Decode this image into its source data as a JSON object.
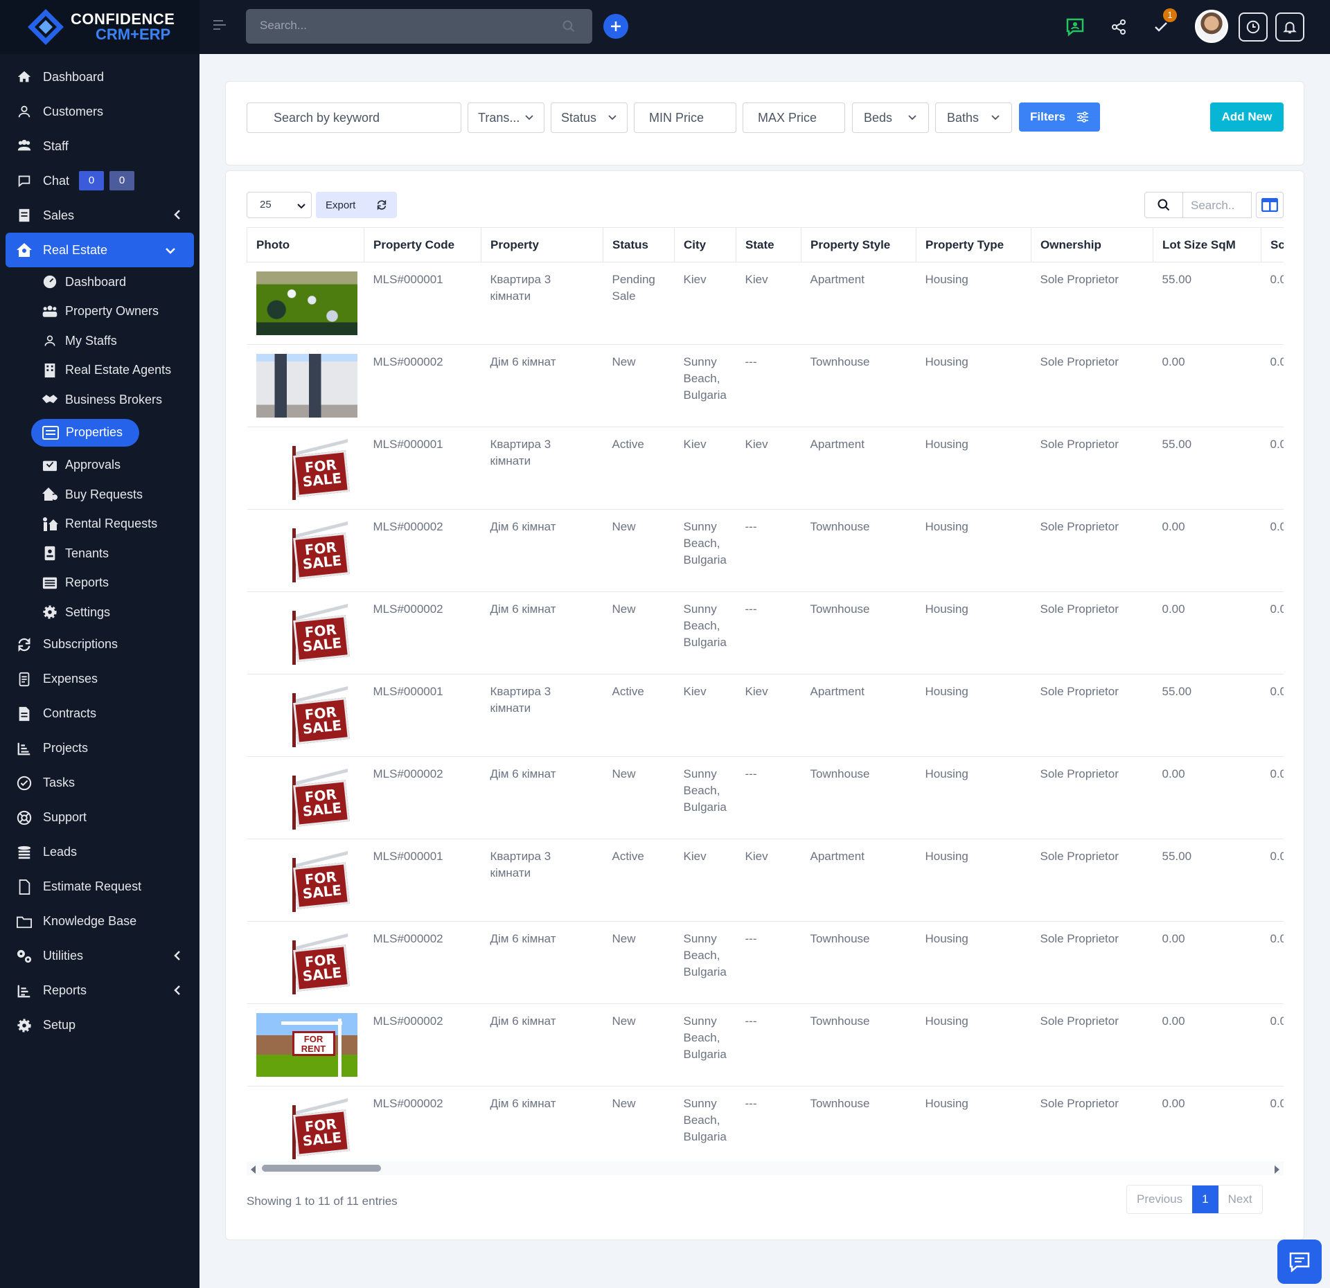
{
  "brand": {
    "line1": "CONFIDENCE",
    "line2": "CRM+ERP"
  },
  "topbar": {
    "search_placeholder": "Search...",
    "notification_count": "1"
  },
  "sidebar": {
    "items_top": [
      {
        "label": "Dashboard",
        "icon": "home-icon"
      },
      {
        "label": "Customers",
        "icon": "user-icon"
      },
      {
        "label": "Staff",
        "icon": "users-icon"
      }
    ],
    "chat": {
      "label": "Chat",
      "badge1": "0",
      "badge2": "0"
    },
    "sales": {
      "label": "Sales"
    },
    "real_estate": {
      "label": "Real Estate"
    },
    "sub_items": [
      {
        "label": "Dashboard",
        "icon": "gauge-icon"
      },
      {
        "label": "Property Owners",
        "icon": "people-icon"
      },
      {
        "label": "My Staffs",
        "icon": "user-icon"
      },
      {
        "label": "Real Estate Agents",
        "icon": "building-icon"
      },
      {
        "label": "Business Brokers",
        "icon": "handshake-icon"
      }
    ],
    "properties": {
      "label": "Properties"
    },
    "sub_items2": [
      {
        "label": "Approvals",
        "icon": "inbox-icon"
      },
      {
        "label": "Buy Requests",
        "icon": "house-tag-icon"
      },
      {
        "label": "Rental Requests",
        "icon": "person-house-icon"
      },
      {
        "label": "Tenants",
        "icon": "id-card-icon"
      },
      {
        "label": "Reports",
        "icon": "list-icon"
      },
      {
        "label": "Settings",
        "icon": "gear-icon"
      }
    ],
    "items_bottom": [
      {
        "label": "Subscriptions",
        "icon": "repeat-icon"
      },
      {
        "label": "Expenses",
        "icon": "receipt-icon"
      },
      {
        "label": "Contracts",
        "icon": "document-icon"
      },
      {
        "label": "Projects",
        "icon": "chart-icon"
      },
      {
        "label": "Tasks",
        "icon": "check-circle-icon"
      },
      {
        "label": "Support",
        "icon": "lifebuoy-icon"
      },
      {
        "label": "Leads",
        "icon": "funnel-icon"
      },
      {
        "label": "Estimate Request",
        "icon": "file-icon"
      },
      {
        "label": "Knowledge Base",
        "icon": "folder-icon"
      }
    ],
    "utilities": {
      "label": "Utilities"
    },
    "reports": {
      "label": "Reports"
    },
    "setup": {
      "label": "Setup"
    }
  },
  "filters": {
    "keyword_placeholder": "Search by keyword",
    "transaction": "Trans...",
    "status": "Status",
    "min_price": "MIN Price",
    "max_price": "MAX Price",
    "beds": "Beds",
    "baths": "Baths",
    "filters_button": "Filters",
    "add_new": "Add New"
  },
  "table_tools": {
    "page_length": "25",
    "export": "Export",
    "search_placeholder": "Search.."
  },
  "columns": [
    "Photo",
    "Property Code",
    "Property",
    "Status",
    "City",
    "State",
    "Property Style",
    "Property Type",
    "Ownership",
    "Lot Size SqM",
    "Sc"
  ],
  "rows": [
    {
      "photo": "aerial",
      "code": "MLS#000001",
      "property": "Квартира 3 кімнати",
      "status": "Pending Sale",
      "city": "Kiev",
      "state": "Kiev",
      "style": "Apartment",
      "type": "Housing",
      "ownership": "Sole Proprietor",
      "lot": "55.00",
      "sc": "0.0"
    },
    {
      "photo": "house",
      "code": "MLS#000002",
      "property": "Дім 6 кімнат",
      "status": "New",
      "city": "Sunny Beach, Bulgaria",
      "state": "---",
      "style": "Townhouse",
      "type": "Housing",
      "ownership": "Sole Proprietor",
      "lot": "0.00",
      "sc": "0.0"
    },
    {
      "photo": "for-sale",
      "code": "MLS#000001",
      "property": "Квартира 3 кімнати",
      "status": "Active",
      "city": "Kiev",
      "state": "Kiev",
      "style": "Apartment",
      "type": "Housing",
      "ownership": "Sole Proprietor",
      "lot": "55.00",
      "sc": "0.0"
    },
    {
      "photo": "for-sale",
      "code": "MLS#000002",
      "property": "Дім 6 кімнат",
      "status": "New",
      "city": "Sunny Beach, Bulgaria",
      "state": "---",
      "style": "Townhouse",
      "type": "Housing",
      "ownership": "Sole Proprietor",
      "lot": "0.00",
      "sc": "0.0"
    },
    {
      "photo": "for-sale",
      "code": "MLS#000002",
      "property": "Дім 6 кімнат",
      "status": "New",
      "city": "Sunny Beach, Bulgaria",
      "state": "---",
      "style": "Townhouse",
      "type": "Housing",
      "ownership": "Sole Proprietor",
      "lot": "0.00",
      "sc": "0.0"
    },
    {
      "photo": "for-sale",
      "code": "MLS#000001",
      "property": "Квартира 3 кімнати",
      "status": "Active",
      "city": "Kiev",
      "state": "Kiev",
      "style": "Apartment",
      "type": "Housing",
      "ownership": "Sole Proprietor",
      "lot": "55.00",
      "sc": "0.0"
    },
    {
      "photo": "for-sale",
      "code": "MLS#000002",
      "property": "Дім 6 кімнат",
      "status": "New",
      "city": "Sunny Beach, Bulgaria",
      "state": "---",
      "style": "Townhouse",
      "type": "Housing",
      "ownership": "Sole Proprietor",
      "lot": "0.00",
      "sc": "0.0"
    },
    {
      "photo": "for-sale",
      "code": "MLS#000001",
      "property": "Квартира 3 кімнати",
      "status": "Active",
      "city": "Kiev",
      "state": "Kiev",
      "style": "Apartment",
      "type": "Housing",
      "ownership": "Sole Proprietor",
      "lot": "55.00",
      "sc": "0.0"
    },
    {
      "photo": "for-sale",
      "code": "MLS#000002",
      "property": "Дім 6 кімнат",
      "status": "New",
      "city": "Sunny Beach, Bulgaria",
      "state": "---",
      "style": "Townhouse",
      "type": "Housing",
      "ownership": "Sole Proprietor",
      "lot": "0.00",
      "sc": "0.0"
    },
    {
      "photo": "for-rent",
      "code": "MLS#000002",
      "property": "Дім 6 кімнат",
      "status": "New",
      "city": "Sunny Beach, Bulgaria",
      "state": "---",
      "style": "Townhouse",
      "type": "Housing",
      "ownership": "Sole Proprietor",
      "lot": "0.00",
      "sc": "0.0"
    },
    {
      "photo": "for-sale",
      "code": "MLS#000002",
      "property": "Дім 6 кімнат",
      "status": "New",
      "city": "Sunny Beach, Bulgaria",
      "state": "---",
      "style": "Townhouse",
      "type": "Housing",
      "ownership": "Sole Proprietor",
      "lot": "0.00",
      "sc": "0.0"
    }
  ],
  "sign_text": {
    "sale1": "FOR",
    "sale2": "SALE",
    "rent1": "FOR",
    "rent2": "RENT"
  },
  "footer": {
    "info": "Showing 1 to 11 of 11 entries",
    "previous": "Previous",
    "page": "1",
    "next": "Next"
  },
  "colors": {
    "accent": "#2563eb",
    "sidebar_bg": "#111827",
    "add_new": "#06b6d4"
  }
}
